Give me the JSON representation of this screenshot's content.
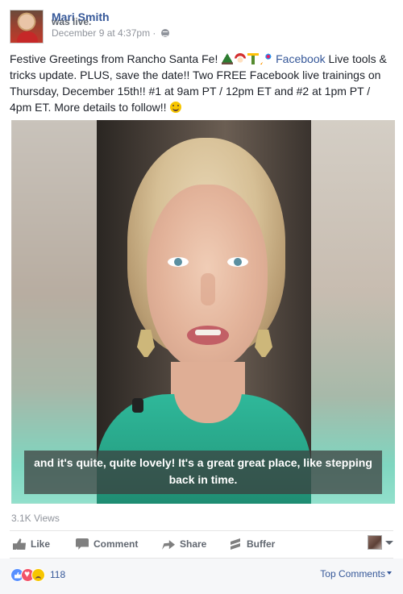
{
  "post": {
    "author": "Mari Smith",
    "action": "was live.",
    "timestamp": "December 9 at 4:37pm",
    "separator": "·",
    "privacy_icon": "globe-icon",
    "text_part1": "Festive Greetings from Rancho Santa Fe!",
    "emojis": [
      "christmas-tree-emoji",
      "santa-emoji",
      "champagne-emoji",
      "party-popper-emoji"
    ],
    "link": "Facebook",
    "text_part2": "Live tools & tricks update. PLUS, save the date!! Two FREE Facebook live trainings on Thursday, December 15th!! #1 at 9am PT / 12pm ET and #2 at 1pm PT / 4pm ET. More details to follow!!",
    "end_emoji": "smile-emoji"
  },
  "video": {
    "caption": "and it's quite, quite lovely! It's a great great place, like stepping back in time."
  },
  "stats": {
    "views": "3.1K Views",
    "reaction_count": "118",
    "reactions": [
      "like",
      "love",
      "sad"
    ]
  },
  "actions": {
    "like": "Like",
    "comment": "Comment",
    "share": "Share",
    "buffer": "Buffer"
  },
  "comments": {
    "sort_label": "Top Comments"
  },
  "colors": {
    "link": "#365899",
    "meta": "#90949c",
    "action": "#616770",
    "footer_bg": "#f6f7f9"
  }
}
